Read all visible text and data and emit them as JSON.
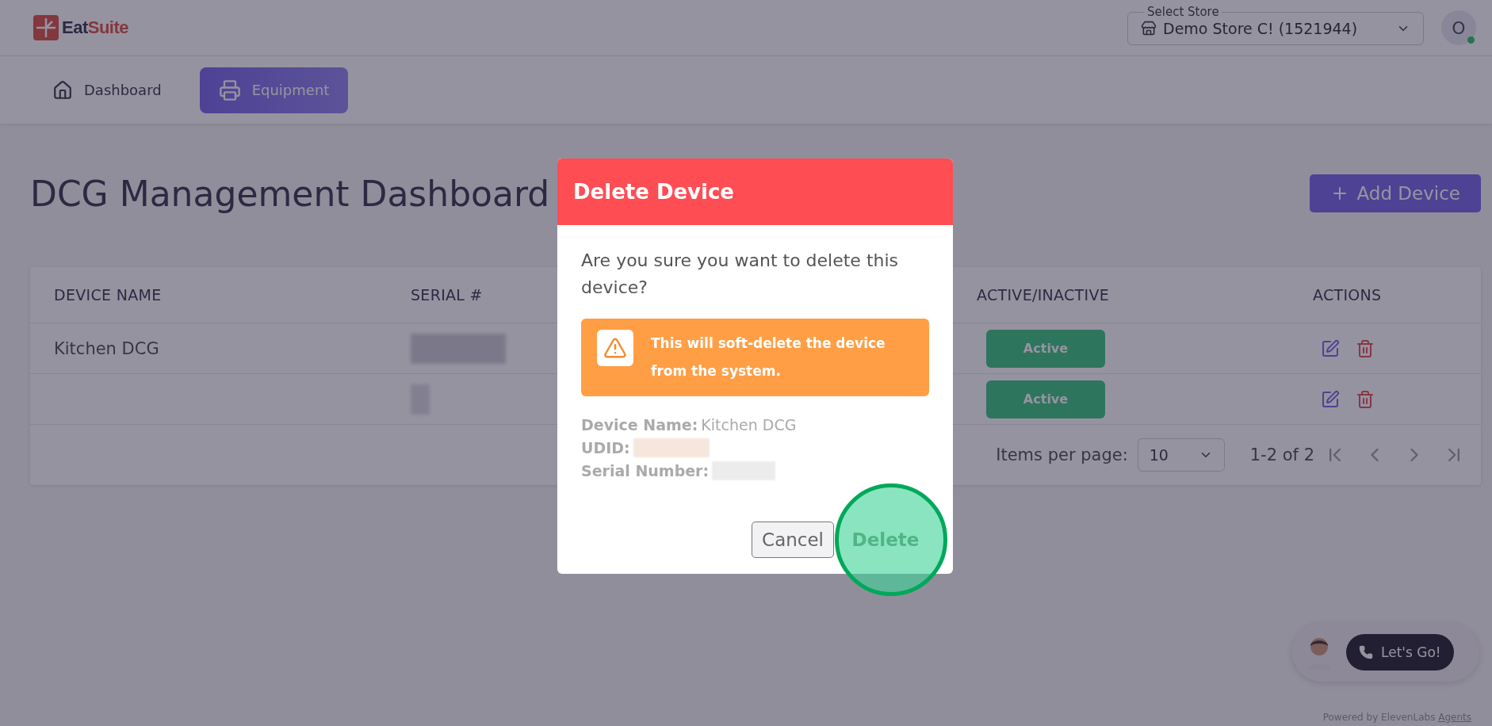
{
  "header": {
    "logo_parts": [
      "Eat",
      "Suite"
    ],
    "store_select": {
      "label": "Select Store",
      "value": "Demo Store C! (1521944)"
    },
    "avatar": {
      "initial": "O",
      "online": true
    }
  },
  "nav": [
    {
      "label": "Dashboard",
      "selected": false
    },
    {
      "label": "Equipment",
      "selected": true
    }
  ],
  "page": {
    "title": "DCG Management Dashboard",
    "add_button": "Add Device"
  },
  "table": {
    "columns": [
      "DEVICE NAME",
      "SERIAL #",
      "ACTIVE/INACTIVE",
      "ACTIONS"
    ],
    "rows": [
      {
        "device_name": "Kitchen DCG",
        "status": "Active"
      },
      {
        "status": "Active"
      }
    ],
    "footer": {
      "items_label": "Items per page:",
      "page_size": "10",
      "range": "1-2 of 2"
    }
  },
  "dialog": {
    "title": "Delete Device",
    "message": "Are you sure you want to delete this device?",
    "warning": "This will soft-delete the device from the system.",
    "details": [
      {
        "label": "Device Name:",
        "value": "Kitchen DCG"
      },
      {
        "label": "UDID:"
      },
      {
        "label": "Serial Number:"
      }
    ],
    "buttons": [
      {
        "label": "Cancel",
        "kind": "secondary",
        "highlighted": false
      },
      {
        "label": "Delete",
        "kind": "danger",
        "highlighted": true
      }
    ]
  },
  "widget": {
    "button": "Let's Go!",
    "powered_by": "Powered by ElevenLabs",
    "link": "Agents"
  }
}
